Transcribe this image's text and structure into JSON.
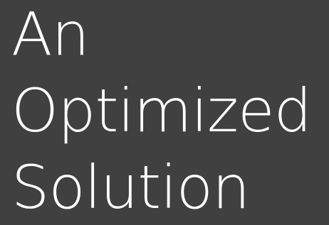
{
  "slide": {
    "title_lines": [
      "An",
      "Optimized",
      "Solution"
    ]
  },
  "colors": {
    "background": "#404040",
    "text": "#ffffff"
  }
}
